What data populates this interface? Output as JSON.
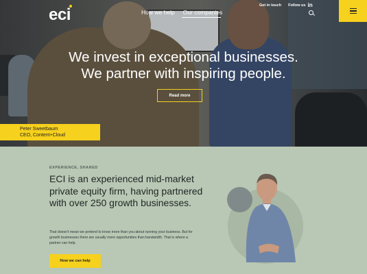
{
  "header": {
    "logo": "eci",
    "nav": [
      "How we help",
      "Our companies"
    ],
    "top_links": {
      "get_in_touch": "Get in touch",
      "follow_us": "Follow us",
      "linkedin": "in"
    }
  },
  "hero": {
    "line1": "We invest in exceptional businesses.",
    "line2": "We partner with inspiring people.",
    "button": "Read more",
    "caption_name": "Peter Sweetbaum",
    "caption_role": "CEO, Content+Cloud"
  },
  "about": {
    "kicker": "EXPERIENCE, SHARED",
    "headline": "ECI is an experienced mid-market private equity firm, having partnered with over 250 growth businesses.",
    "body": "That doesn't mean we pretend to know more than you about running your business. But for growth businesses there are usually more opportunities than bandwidth. That is where a partner can help.",
    "cta": "How we can help"
  },
  "colors": {
    "accent": "#f6d11d",
    "section_bg": "#b9c7b5"
  }
}
